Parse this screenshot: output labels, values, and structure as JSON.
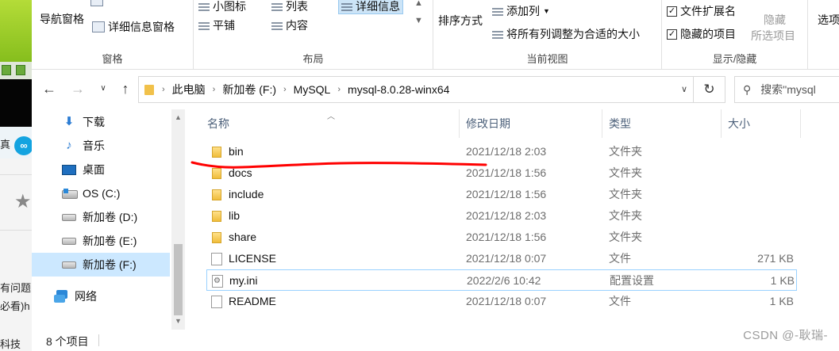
{
  "background_app": {
    "snippets": [
      "真",
      "有问题",
      "必看)h",
      "科技"
    ],
    "badge": "∞"
  },
  "ribbon": {
    "pane_group": {
      "name": "窗格",
      "nav_pane": "导航窗格",
      "detail_pane": "详细信息窗格"
    },
    "layout_group": {
      "name": "布局",
      "items": [
        "小图标",
        "平铺",
        "列表",
        "内容",
        "详细信息"
      ]
    },
    "view_group": {
      "name": "当前视图",
      "sort_by": "排序方式",
      "add_column": "添加列",
      "fit_columns": "将所有列调整为合适的大小"
    },
    "show_group": {
      "name": "显示/隐藏",
      "file_ext": {
        "label": "文件扩展名",
        "checked": true
      },
      "hidden_items": {
        "label": "隐藏的项目",
        "checked": true
      },
      "hide_selected": "隐藏",
      "hide_selected_sub": "所选项目",
      "options": "选项"
    }
  },
  "address_bar": {
    "path": [
      "此电脑",
      "新加卷 (F:)",
      "MySQL",
      "mysql-8.0.28-winx64"
    ],
    "search_placeholder": "搜索\"mysql"
  },
  "nav_pane": {
    "items": [
      {
        "label": "下载",
        "icon": "download-icon"
      },
      {
        "label": "音乐",
        "icon": "music-icon"
      },
      {
        "label": "桌面",
        "icon": "desktop-icon"
      },
      {
        "label": "OS (C:)",
        "icon": "os-drive-icon"
      },
      {
        "label": "新加卷 (D:)",
        "icon": "drive-icon"
      },
      {
        "label": "新加卷 (E:)",
        "icon": "drive-icon"
      },
      {
        "label": "新加卷 (F:)",
        "icon": "drive-icon",
        "selected": true
      },
      {
        "label": "网络",
        "icon": "network-icon"
      }
    ]
  },
  "file_list": {
    "columns": [
      "名称",
      "修改日期",
      "类型",
      "大小"
    ],
    "rows": [
      {
        "name": "bin",
        "date": "2021/12/18 2:03",
        "type": "文件夹",
        "size": "",
        "icon": "folder-icon"
      },
      {
        "name": "docs",
        "date": "2021/12/18 1:56",
        "type": "文件夹",
        "size": "",
        "icon": "folder-icon"
      },
      {
        "name": "include",
        "date": "2021/12/18 1:56",
        "type": "文件夹",
        "size": "",
        "icon": "folder-icon"
      },
      {
        "name": "lib",
        "date": "2021/12/18 2:03",
        "type": "文件夹",
        "size": "",
        "icon": "folder-icon"
      },
      {
        "name": "share",
        "date": "2021/12/18 1:56",
        "type": "文件夹",
        "size": "",
        "icon": "folder-icon"
      },
      {
        "name": "LICENSE",
        "date": "2021/12/18 0:07",
        "type": "文件",
        "size": "271 KB",
        "icon": "file-icon"
      },
      {
        "name": "my.ini",
        "date": "2022/2/6 10:42",
        "type": "配置设置",
        "size": "1 KB",
        "icon": "ini-file-icon",
        "highlighted": true
      },
      {
        "name": "README",
        "date": "2021/12/18 0:07",
        "type": "文件",
        "size": "1 KB",
        "icon": "file-icon"
      }
    ]
  },
  "status_bar": {
    "item_count": "8 个项目"
  },
  "watermark": "CSDN @-耿瑞-",
  "colors": {
    "annotation_red": "#ff0000",
    "selection_blue": "#cce8ff",
    "folder_yellow": "#f1c14a"
  }
}
